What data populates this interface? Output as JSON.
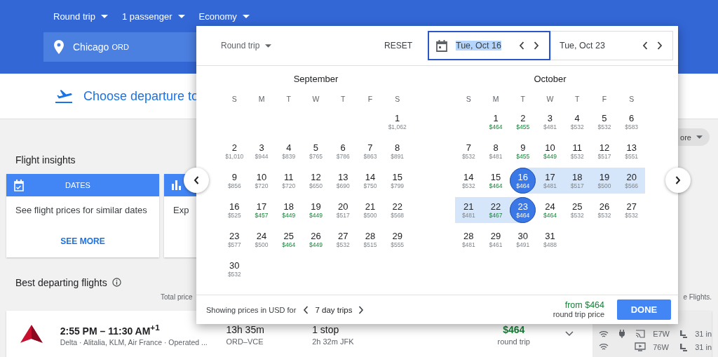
{
  "header": {
    "dropdowns": [
      {
        "label": "Round trip"
      },
      {
        "label": "1 passenger"
      },
      {
        "label": "Economy"
      }
    ],
    "origin": {
      "city": "Chicago",
      "code": "ORD"
    }
  },
  "banner": {
    "title": "Choose departure to"
  },
  "more_chip": {
    "label": "ore"
  },
  "insights": {
    "title": "Flight insights",
    "cards": [
      {
        "kind": "dates",
        "header": "DATES",
        "body": "See flight prices for similar dates",
        "link": "SEE MORE"
      },
      {
        "kind": "chart",
        "body": "Exp"
      }
    ]
  },
  "best_flights": {
    "title": "Best departing flights",
    "total_price_note": "Total price",
    "right_note": "e Flights."
  },
  "flights": [
    {
      "times": "2:55 PM – 11:30 AM$^{+1}$",
      "airlines": "Delta · Alitalia, KLM, Air France · Operated ...",
      "duration": "13h 35m",
      "route": "ORD–VCE",
      "stops": "1 stop",
      "layover": "2h 32m JFK",
      "price": "$464",
      "price_note": "round trip",
      "amenities": [
        {
          "wifi": true,
          "power": true,
          "streaming": true,
          "seatback_screen": false,
          "aircraft": "E7W",
          "legroom": "31 in"
        },
        {
          "wifi": true,
          "power": false,
          "streaming": false,
          "seatback_screen": true,
          "aircraft": "76W",
          "legroom": "31 in"
        }
      ]
    }
  ],
  "date_picker": {
    "trip_type": "Round trip",
    "reset": "RESET",
    "dates": [
      {
        "label": "Tue, Oct 16",
        "selected": true
      },
      {
        "label": "Tue, Oct 23",
        "selected": false
      }
    ],
    "months": [
      {
        "name": "September",
        "weekdays": [
          "S",
          "M",
          "T",
          "W",
          "T",
          "F",
          "S"
        ],
        "weeks": [
          [
            {
              "kind": "blank"
            },
            {
              "kind": "blank"
            },
            {
              "kind": "blank"
            },
            {
              "kind": "blank"
            },
            {
              "kind": "blank"
            },
            {
              "kind": "blank"
            },
            {
              "kind": "day",
              "day": "1",
              "price": "$1,062",
              "cheap": false,
              "selected": false,
              "in_range": false
            }
          ],
          [
            {
              "day": "2",
              "price": "$1,010",
              "cheap": false,
              "selected": false,
              "in_range": false
            },
            {
              "day": "3",
              "price": "$944",
              "cheap": false,
              "selected": false,
              "in_range": false
            },
            {
              "day": "4",
              "price": "$839",
              "cheap": false,
              "selected": false,
              "in_range": false
            },
            {
              "day": "5",
              "price": "$765",
              "cheap": false,
              "selected": false,
              "in_range": false
            },
            {
              "day": "6",
              "price": "$786",
              "cheap": false,
              "selected": false,
              "in_range": false
            },
            {
              "day": "7",
              "price": "$863",
              "cheap": false,
              "selected": false,
              "in_range": false
            },
            {
              "day": "8",
              "price": "$891",
              "cheap": false,
              "selected": false,
              "in_range": false
            }
          ],
          [
            {
              "day": "9",
              "price": "$856",
              "cheap": false,
              "selected": false,
              "in_range": false
            },
            {
              "day": "10",
              "price": "$720",
              "cheap": false,
              "selected": false,
              "in_range": false
            },
            {
              "day": "11",
              "price": "$720",
              "cheap": false,
              "selected": false,
              "in_range": false
            },
            {
              "day": "12",
              "price": "$650",
              "cheap": false,
              "selected": false,
              "in_range": false
            },
            {
              "day": "13",
              "price": "$690",
              "cheap": false,
              "selected": false,
              "in_range": false
            },
            {
              "day": "14",
              "price": "$750",
              "cheap": false,
              "selected": false,
              "in_range": false
            },
            {
              "day": "15",
              "price": "$799",
              "cheap": false,
              "selected": false,
              "in_range": false
            }
          ],
          [
            {
              "day": "16",
              "price": "$525",
              "cheap": false,
              "selected": false,
              "in_range": false
            },
            {
              "day": "17",
              "price": "$457",
              "cheap": true,
              "selected": false,
              "in_range": false
            },
            {
              "day": "18",
              "price": "$449",
              "cheap": true,
              "selected": false,
              "in_range": false
            },
            {
              "day": "19",
              "price": "$449",
              "cheap": true,
              "selected": false,
              "in_range": false
            },
            {
              "day": "20",
              "price": "$517",
              "cheap": false,
              "selected": false,
              "in_range": false
            },
            {
              "day": "21",
              "price": "$500",
              "cheap": false,
              "selected": false,
              "in_range": false
            },
            {
              "day": "22",
              "price": "$568",
              "cheap": false,
              "selected": false,
              "in_range": false
            }
          ],
          [
            {
              "day": "23",
              "price": "$577",
              "cheap": false,
              "selected": false,
              "in_range": false
            },
            {
              "day": "24",
              "price": "$500",
              "cheap": false,
              "selected": false,
              "in_range": false
            },
            {
              "day": "25",
              "price": "$464",
              "cheap": true,
              "selected": false,
              "in_range": false
            },
            {
              "day": "26",
              "price": "$449",
              "cheap": true,
              "selected": false,
              "in_range": false
            },
            {
              "day": "27",
              "price": "$532",
              "cheap": false,
              "selected": false,
              "in_range": false
            },
            {
              "day": "28",
              "price": "$515",
              "cheap": false,
              "selected": false,
              "in_range": false
            },
            {
              "day": "29",
              "price": "$555",
              "cheap": false,
              "selected": false,
              "in_range": false
            }
          ],
          [
            {
              "day": "30",
              "price": "$532",
              "cheap": false,
              "selected": false,
              "in_range": false
            }
          ]
        ]
      },
      {
        "name": "October",
        "weekdays": [
          "S",
          "M",
          "T",
          "W",
          "T",
          "F",
          "S"
        ],
        "weeks": [
          [
            {
              "kind": "blank"
            },
            {
              "kind": "day",
              "day": "1",
              "price": "$464",
              "cheap": true,
              "selected": false,
              "in_range": false
            },
            {
              "day": "2",
              "price": "$455",
              "cheap": true,
              "selected": false,
              "in_range": false
            },
            {
              "day": "3",
              "price": "$481",
              "cheap": false,
              "selected": false,
              "in_range": false
            },
            {
              "day": "4",
              "price": "$532",
              "cheap": false,
              "selected": false,
              "in_range": false
            },
            {
              "day": "5",
              "price": "$532",
              "cheap": false,
              "selected": false,
              "in_range": false
            },
            {
              "day": "6",
              "price": "$583",
              "cheap": false,
              "selected": false,
              "in_range": false
            }
          ],
          [
            {
              "day": "7",
              "price": "$532",
              "cheap": false,
              "selected": false,
              "in_range": false
            },
            {
              "day": "8",
              "price": "$481",
              "cheap": false,
              "selected": false,
              "in_range": false
            },
            {
              "day": "9",
              "price": "$455",
              "cheap": true,
              "selected": false,
              "in_range": false
            },
            {
              "day": "10",
              "price": "$449",
              "cheap": true,
              "selected": false,
              "in_range": false
            },
            {
              "day": "11",
              "price": "$532",
              "cheap": false,
              "selected": false,
              "in_range": false
            },
            {
              "day": "12",
              "price": "$517",
              "cheap": false,
              "selected": false,
              "in_range": false
            },
            {
              "day": "13",
              "price": "$551",
              "cheap": false,
              "selected": false,
              "in_range": false
            }
          ],
          [
            {
              "day": "14",
              "price": "$532",
              "cheap": false,
              "selected": false,
              "in_range": false
            },
            {
              "day": "15",
              "price": "$464",
              "cheap": true,
              "selected": false,
              "in_range": false
            },
            {
              "day": "16",
              "price": "$464",
              "cheap": true,
              "selected": true,
              "in_range": false
            },
            {
              "day": "17",
              "price": "$481",
              "cheap": false,
              "selected": false,
              "in_range": true
            },
            {
              "day": "18",
              "price": "$517",
              "cheap": false,
              "selected": false,
              "in_range": true
            },
            {
              "day": "19",
              "price": "$500",
              "cheap": false,
              "selected": false,
              "in_range": true
            },
            {
              "day": "20",
              "price": "$566",
              "cheap": false,
              "selected": false,
              "in_range": true
            }
          ],
          [
            {
              "day": "21",
              "price": "$481",
              "cheap": false,
              "selected": false,
              "in_range": true
            },
            {
              "day": "22",
              "price": "$467",
              "cheap": true,
              "selected": false,
              "in_range": true
            },
            {
              "day": "23",
              "price": "$464",
              "cheap": true,
              "selected": true,
              "in_range": false
            },
            {
              "day": "24",
              "price": "$464",
              "cheap": true,
              "selected": false,
              "in_range": false
            },
            {
              "day": "25",
              "price": "$532",
              "cheap": false,
              "selected": false,
              "in_range": false
            },
            {
              "day": "26",
              "price": "$532",
              "cheap": false,
              "selected": false,
              "in_range": false
            },
            {
              "day": "27",
              "price": "$532",
              "cheap": false,
              "selected": false,
              "in_range": false
            }
          ],
          [
            {
              "day": "28",
              "price": "$481",
              "cheap": false,
              "selected": false,
              "in_range": false
            },
            {
              "day": "29",
              "price": "$461",
              "cheap": false,
              "selected": false,
              "in_range": false
            },
            {
              "day": "30",
              "price": "$491",
              "cheap": false,
              "selected": false,
              "in_range": false
            },
            {
              "day": "31",
              "price": "$488",
              "cheap": false,
              "selected": false,
              "in_range": false
            }
          ]
        ]
      }
    ],
    "footer": {
      "note": "Showing prices in USD for",
      "trip_length": "7 day trips",
      "from_price": "from $464",
      "price_note": "round trip price",
      "done": "DONE"
    }
  }
}
